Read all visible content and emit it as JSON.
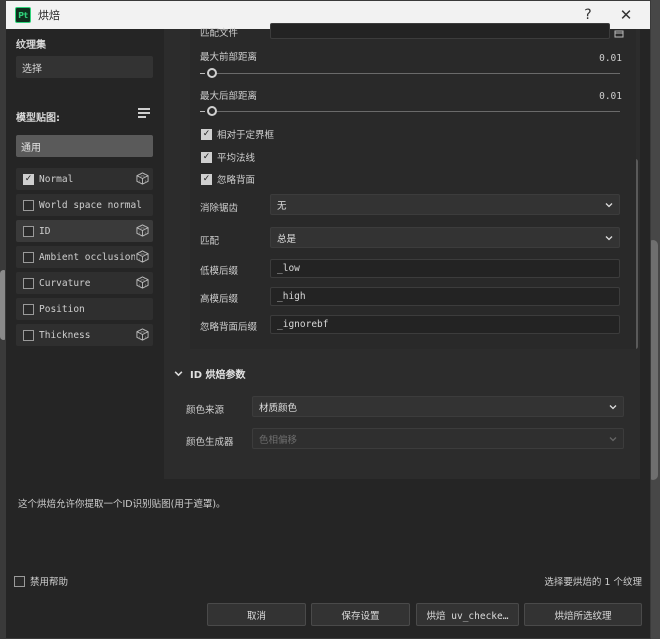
{
  "window": {
    "app_logo": "Pt",
    "title": "烘焙",
    "help_glyph": "?",
    "close_glyph": "✕"
  },
  "sidebar": {
    "texture_set_label": "纹理集",
    "texture_set_value": "选择",
    "model_maps_label": "模型贴图:",
    "common_label": "通用",
    "maps": [
      {
        "label": "Normal",
        "checked": true
      },
      {
        "label": "World space normal",
        "checked": false
      },
      {
        "label": "ID",
        "checked": false
      },
      {
        "label": "Ambient occlusion",
        "checked": false
      },
      {
        "label": "Curvature",
        "checked": false
      },
      {
        "label": "Position",
        "checked": false
      },
      {
        "label": "Thickness",
        "checked": false
      }
    ]
  },
  "common": {
    "partial_top_label": "匹配文件",
    "max_front_label": "最大前部距离",
    "max_front_value": "0.01",
    "max_rear_label": "最大后部距离",
    "max_rear_value": "0.01",
    "relative_bbox_label": "相对于定界框",
    "average_normals_label": "平均法线",
    "ignore_backface_label": "忽略背面",
    "antialias_label": "消除锯齿",
    "antialias_value": "无",
    "match_label": "匹配",
    "match_value": "总是",
    "low_suffix_label": "低模后缀",
    "low_suffix_value": "_low",
    "high_suffix_label": "高模后缀",
    "high_suffix_value": "_high",
    "ignore_suffix_label": "忽略背面后缀",
    "ignore_suffix_value": "_ignorebf"
  },
  "id_section": {
    "header": "ID 烘焙参数",
    "color_source_label": "颜色来源",
    "color_source_value": "材质颜色",
    "color_generator_label": "颜色生成器",
    "color_generator_value": "色相偏移"
  },
  "description": "这个烘焙允许你提取一个ID识别贴图(用于遮罩)。",
  "footer": {
    "disable_help_label": "禁用帮助",
    "status": "选择要烘焙的 1 个纹理",
    "cancel": "取消",
    "save_settings": "保存设置",
    "bake_current": "烘焙 uv_checke…",
    "bake_selected": "烘焙所选纹理"
  }
}
